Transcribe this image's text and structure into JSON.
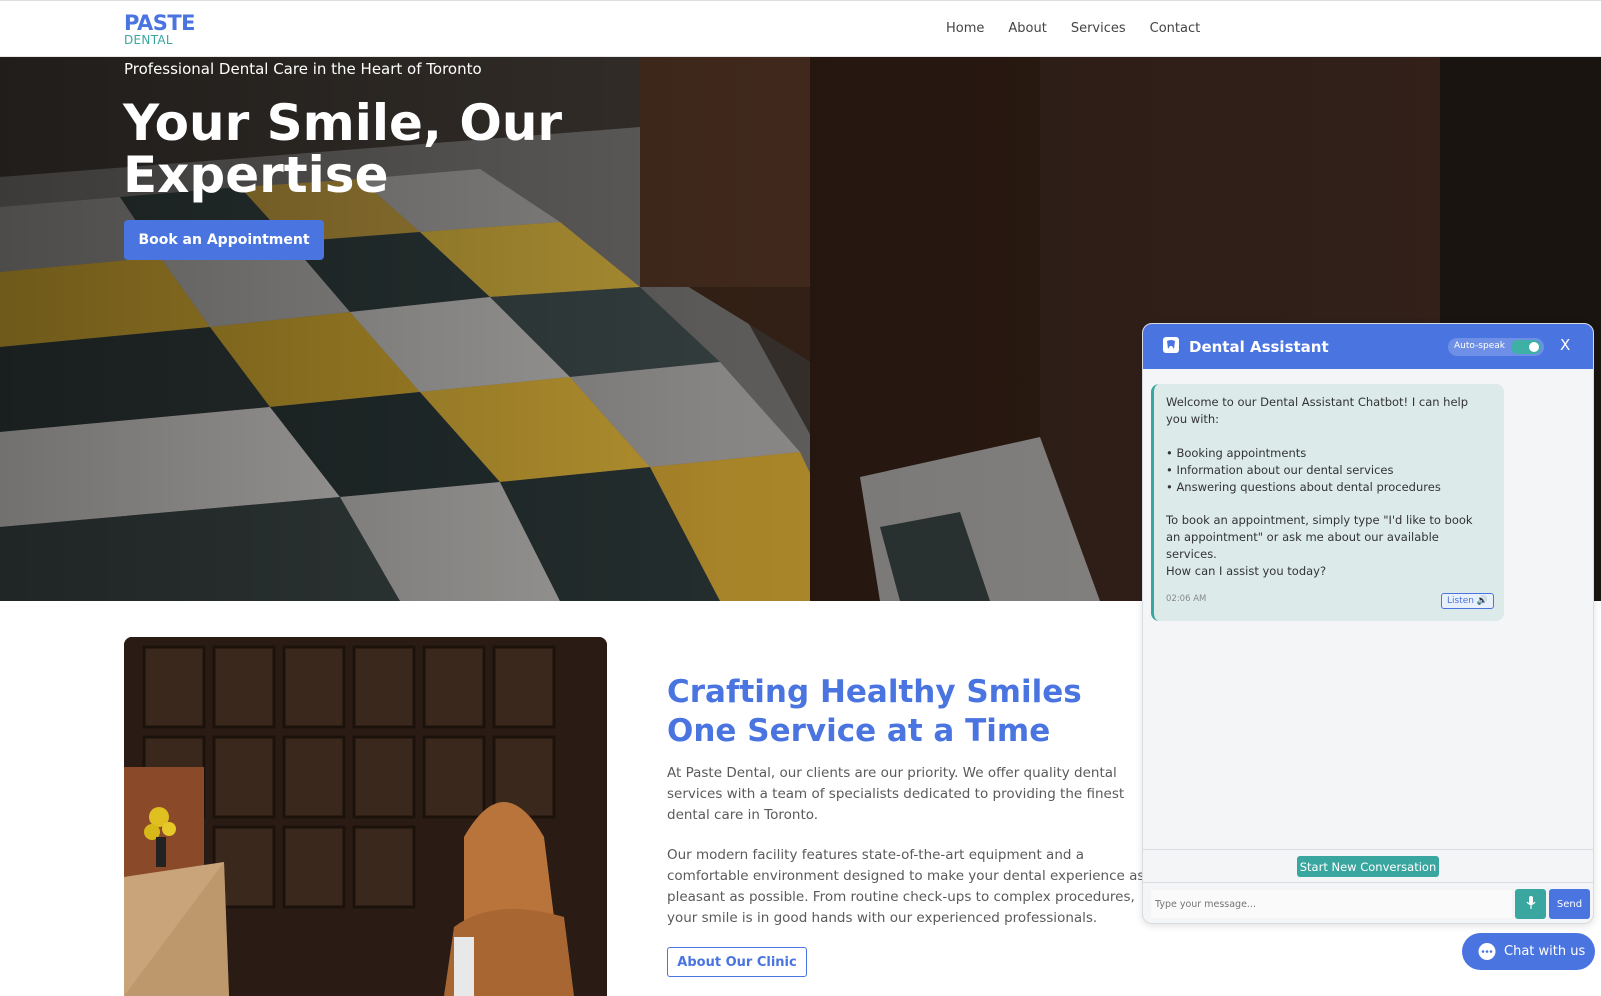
{
  "brand": {
    "line1": "PASTE",
    "line2": "DENTAL"
  },
  "nav": {
    "items": [
      "Home",
      "About",
      "Services",
      "Contact"
    ]
  },
  "hero": {
    "subtitle": "Professional Dental Care in the Heart of Toronto",
    "title": "Your Smile, Our Expertise",
    "cta": "Book an Appointment"
  },
  "about": {
    "title": "Crafting Healthy Smiles One Service at a Time",
    "para1": "At Paste Dental, our clients are our priority. We offer quality dental services with a team of specialists dedicated to providing the finest dental care in Toronto.",
    "para2": "Our modern facility features state-of-the-art equipment and a comfortable environment designed to make your dental experience as pleasant as possible. From routine check-ups to complex procedures, your smile is in good hands with our experienced professionals.",
    "button": "About Our Clinic"
  },
  "chat": {
    "title": "Dental Assistant",
    "auto_speak": "Auto-speak",
    "auto_speak_on": true,
    "close": "X",
    "message": {
      "intro": "Welcome to our Dental Assistant Chatbot! I can help you with:",
      "bullets": [
        "• Booking appointments",
        "• Information about our dental services",
        "• Answering questions about dental procedures"
      ],
      "booking": "To book an appointment, simply type \"I'd like to book an appointment\" or ask me about our available services.",
      "question": "How can I assist you today?",
      "time": "02:06 AM",
      "listen": "Listen 🔊"
    },
    "start_new": "Start New Conversation",
    "input_placeholder": "Type your message...",
    "send": "Send",
    "launcher": "Chat with us"
  },
  "colors": {
    "primary": "#4a74e0",
    "teal": "#3aa6a0"
  }
}
